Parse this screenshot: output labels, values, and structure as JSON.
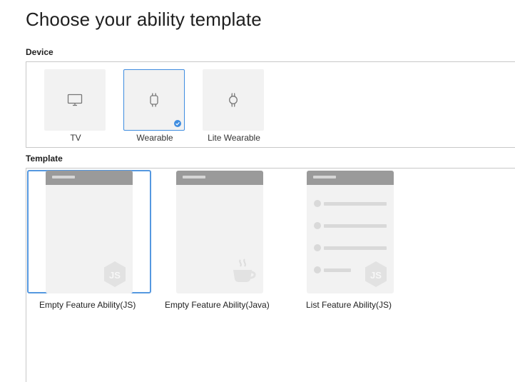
{
  "page": {
    "title": "Choose your ability template"
  },
  "device_section": {
    "label": "Device",
    "devices": [
      {
        "label": "TV",
        "icon": "monitor-icon",
        "selected": false
      },
      {
        "label": "Wearable",
        "icon": "smartwatch-icon",
        "selected": true
      },
      {
        "label": "Lite Wearable",
        "icon": "round-watch-icon",
        "selected": false
      }
    ]
  },
  "template_section": {
    "label": "Template",
    "templates": [
      {
        "label": "Empty Feature Ability(JS)",
        "icon": "js-logo-icon",
        "selected": true
      },
      {
        "label": "Empty Feature Ability(Java)",
        "icon": "java-cup-icon",
        "selected": false
      },
      {
        "label": "List Feature Ability(JS)",
        "icon": "js-logo-icon",
        "selected": false
      }
    ]
  },
  "colors": {
    "accent": "#3f8de0",
    "tile": "#f2f2f2",
    "header_bar": "#9a9a9a",
    "border": "#c8c8c8"
  }
}
